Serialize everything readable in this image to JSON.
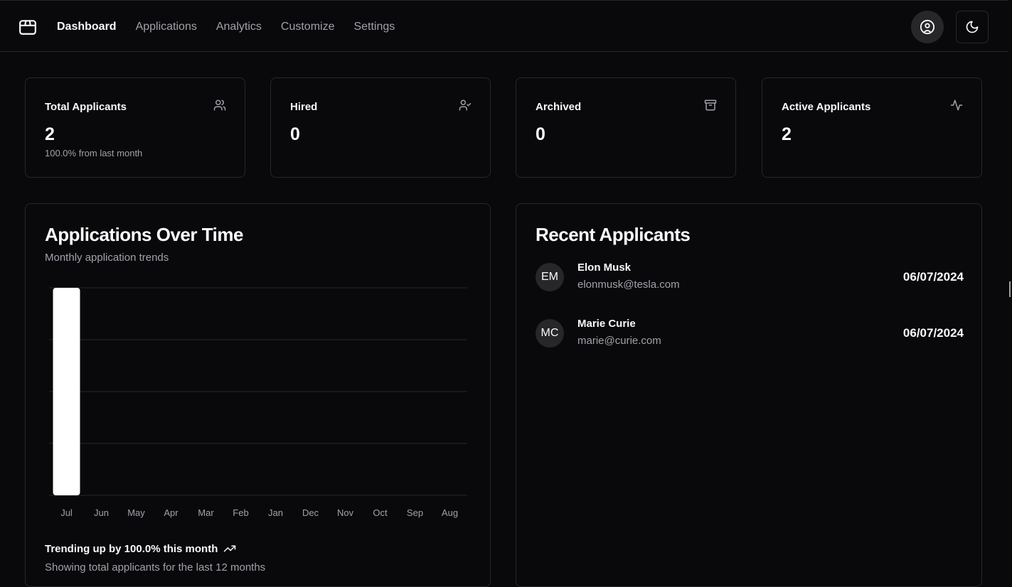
{
  "nav": {
    "items": [
      {
        "label": "Dashboard",
        "active": true
      },
      {
        "label": "Applications",
        "active": false
      },
      {
        "label": "Analytics",
        "active": false
      },
      {
        "label": "Customize",
        "active": false
      },
      {
        "label": "Settings",
        "active": false
      }
    ],
    "icons": {
      "logo": "package-icon",
      "user": "user-circle-icon",
      "theme": "moon-icon"
    }
  },
  "stats": [
    {
      "label": "Total Applicants",
      "value": "2",
      "sub": "100.0% from last month",
      "icon": "users-icon"
    },
    {
      "label": "Hired",
      "value": "0",
      "sub": "",
      "icon": "user-check-icon"
    },
    {
      "label": "Archived",
      "value": "0",
      "sub": "",
      "icon": "archive-icon"
    },
    {
      "label": "Active Applicants",
      "value": "2",
      "sub": "",
      "icon": "activity-icon"
    }
  ],
  "chart_card": {
    "title": "Applications Over Time",
    "description": "Monthly application trends",
    "trend_text": "Trending up by 100.0% this month",
    "trend_sub": "Showing total applicants for the last 12 months"
  },
  "chart_data": {
    "type": "bar",
    "categories": [
      "Jul",
      "Jun",
      "May",
      "Apr",
      "Mar",
      "Feb",
      "Jan",
      "Dec",
      "Nov",
      "Oct",
      "Sep",
      "Aug"
    ],
    "values": [
      2,
      0,
      0,
      0,
      0,
      0,
      0,
      0,
      0,
      0,
      0,
      0
    ],
    "ylim": [
      0,
      2
    ],
    "grid": true,
    "bar_color": "#ffffff",
    "grid_color": "#27272a"
  },
  "recent": {
    "title": "Recent Applicants",
    "applicants": [
      {
        "initials": "EM",
        "name": "Elon Musk",
        "email": "elonmusk@tesla.com",
        "date": "06/07/2024"
      },
      {
        "initials": "MC",
        "name": "Marie Curie",
        "email": "marie@curie.com",
        "date": "06/07/2024"
      }
    ]
  },
  "colors": {
    "background": "#09090b",
    "border": "#27272a",
    "muted_text": "#a1a1aa",
    "text": "#fafafa"
  }
}
